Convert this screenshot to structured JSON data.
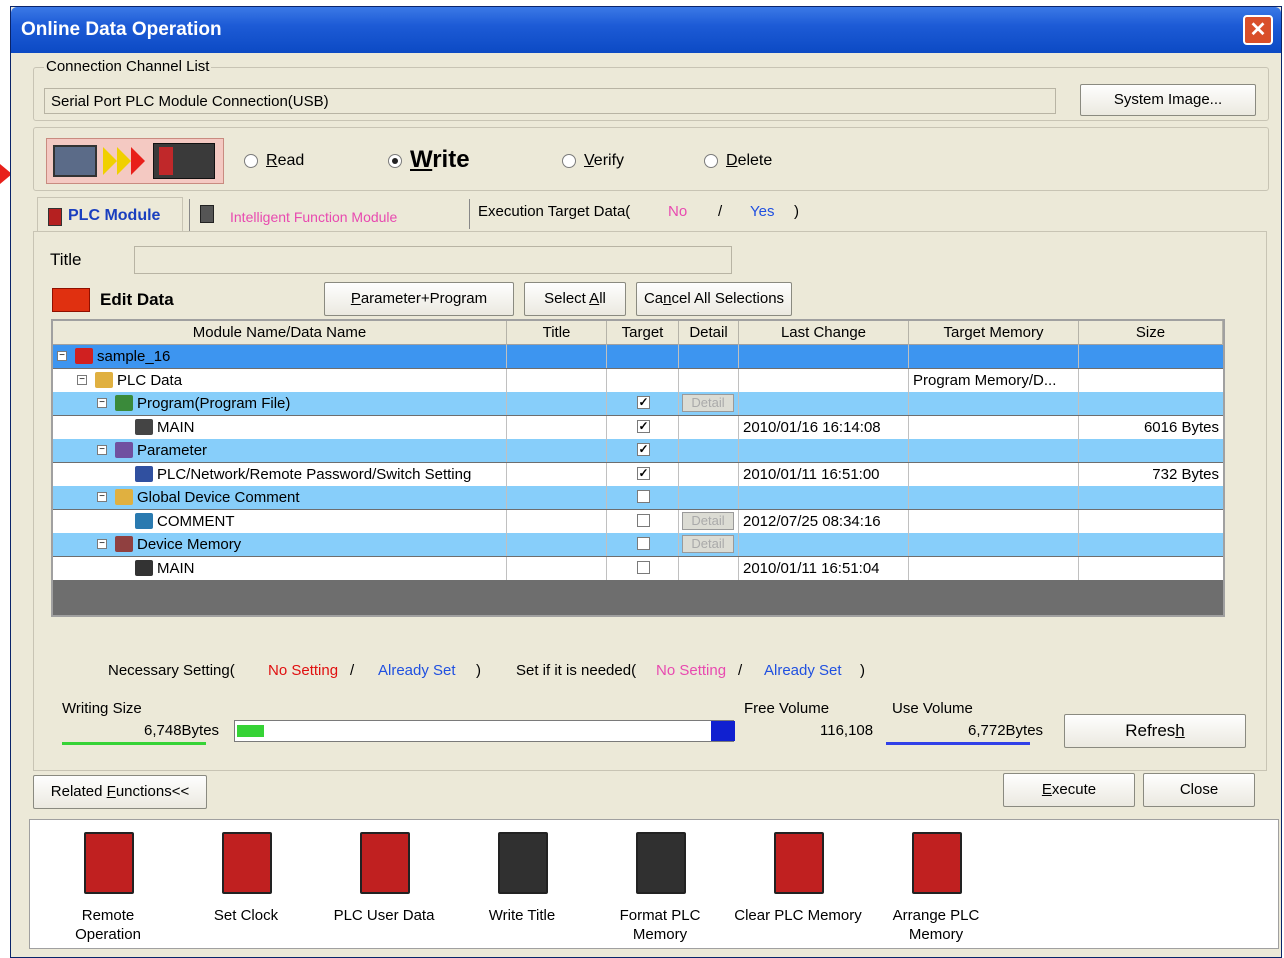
{
  "window": {
    "title": "Online Data Operation",
    "close": "✕"
  },
  "connection": {
    "legend": "Connection Channel List",
    "value": "Serial Port  PLC Module Connection(USB)",
    "system_image_btn": "System Image..."
  },
  "mode": {
    "read": "Read",
    "write": "Write",
    "verify": "Verify",
    "delete": "Delete",
    "selected": "write"
  },
  "tabs": {
    "plc_module": "PLC Module",
    "intelligent": "Intelligent Function Module",
    "exec_target_prefix": "Execution Target Data(",
    "exec_no": "No",
    "exec_sep": "/",
    "exec_yes": "Yes",
    "exec_close": ")"
  },
  "title_field": {
    "label": "Title",
    "value": ""
  },
  "edit_data": {
    "label": "Edit Data",
    "param_prog_btn": "Parameter+Program",
    "select_all_btn": "Select All",
    "cancel_all_btn": "Cancel All Selections"
  },
  "grid": {
    "columns": [
      "Module Name/Data Name",
      "Title",
      "Target",
      "Detail",
      "Last Change",
      "Target Memory",
      "Size"
    ],
    "rows": [
      {
        "name": "sample_16",
        "check": "",
        "detail": "",
        "last": "",
        "mem": "",
        "size": ""
      },
      {
        "name": "PLC Data",
        "check": "",
        "detail": "",
        "last": "",
        "mem": "Program Memory/D...",
        "size": ""
      },
      {
        "name": "Program(Program File)",
        "check": "✓",
        "detail": "Detail",
        "last": "",
        "mem": "",
        "size": ""
      },
      {
        "name": "MAIN",
        "check": "✓",
        "detail": "",
        "last": "2010/01/16 16:14:08",
        "mem": "",
        "size": "6016 Bytes"
      },
      {
        "name": "Parameter",
        "check": "✓",
        "detail": "",
        "last": "",
        "mem": "",
        "size": ""
      },
      {
        "name": "PLC/Network/Remote Password/Switch Setting",
        "check": "✓",
        "detail": "",
        "last": "2010/01/11 16:51:00",
        "mem": "",
        "size": "732 Bytes"
      },
      {
        "name": "Global Device Comment",
        "check": "",
        "detail": "",
        "last": "",
        "mem": "",
        "size": ""
      },
      {
        "name": "COMMENT",
        "check": "",
        "detail": "Detail",
        "last": "2012/07/25 08:34:16",
        "mem": "",
        "size": ""
      },
      {
        "name": "Device Memory",
        "check": "",
        "detail": "Detail",
        "last": "",
        "mem": "",
        "size": ""
      },
      {
        "name": "MAIN",
        "check": "",
        "detail": "",
        "last": "2010/01/11 16:51:04",
        "mem": "",
        "size": ""
      }
    ]
  },
  "legend_line": {
    "necessary": "Necessary Setting(",
    "no_setting": "No Setting",
    "slash": "/",
    "already": "Already Set",
    "close": ")",
    "if_needed": "Set if it is needed(",
    "no_setting2": "No Setting",
    "already2": "Already Set"
  },
  "sizes": {
    "writing_label": "Writing Size",
    "writing_value": "6,748Bytes",
    "free_label": "Free Volume",
    "free_value": "116,108",
    "use_label": "Use Volume",
    "use_value": "6,772Bytes",
    "refresh_btn": "Refresh",
    "writing_fill_fraction": 0.055
  },
  "buttons": {
    "related": "Related Functions<<",
    "execute": "Execute",
    "close": "Close"
  },
  "functions": [
    {
      "label1": "Remote",
      "label2": "Operation",
      "icon": "remote-operation-icon"
    },
    {
      "label1": "Set Clock",
      "label2": "",
      "icon": "set-clock-icon"
    },
    {
      "label1": "PLC User Data",
      "label2": "",
      "icon": "plc-user-data-icon"
    },
    {
      "label1": "Write Title",
      "label2": "",
      "icon": "write-title-icon"
    },
    {
      "label1": "Format PLC",
      "label2": "Memory",
      "icon": "format-plc-memory-icon"
    },
    {
      "label1": "Clear PLC Memory",
      "label2": "",
      "icon": "clear-plc-memory-icon"
    },
    {
      "label1": "Arrange PLC",
      "label2": "Memory",
      "icon": "arrange-plc-memory-icon"
    }
  ],
  "colors": {
    "row_blue": "#87cefa",
    "row_white": "#ffffff",
    "row_selected": "#3d95f0",
    "title_blue": "#1d5bd6"
  }
}
